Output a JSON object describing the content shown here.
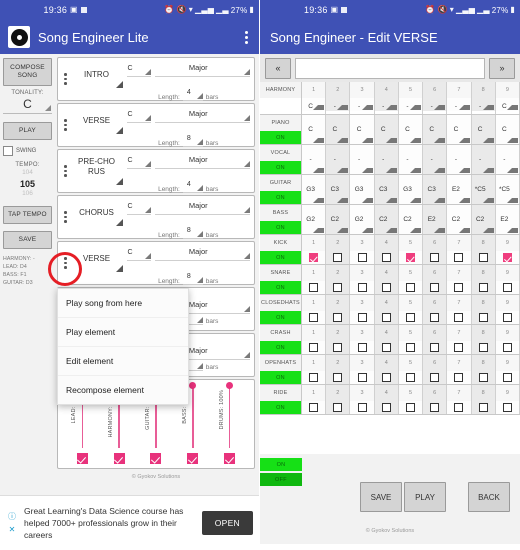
{
  "status_bar": {
    "time": "19:36",
    "battery": "27%",
    "icons": [
      "image-icon",
      "sim-icon",
      "alarm-icon",
      "mute-icon",
      "wifi-icon",
      "signal-icon",
      "signal2-icon"
    ]
  },
  "left": {
    "app_title": "Song Engineer Lite",
    "menu_icon": "kebab-menu-icon",
    "sidebar": {
      "compose_label": "COMPOSE\nSONG",
      "tonality_label": "TONALITY:",
      "tonality_value": "C",
      "play_label": "PLAY",
      "swing_label": "SWING",
      "tempo_label": "TEMPO:",
      "tempo_prev": "104",
      "tempo_current": "105",
      "tempo_next": "106",
      "tap_tempo_label": "TAP TEMPO",
      "save_label": "SAVE",
      "info_lines": [
        "HARMONY: -",
        "LEAD: D4",
        "BASS: F1",
        "GUITAR: D3"
      ]
    },
    "length_prefix": "Length:",
    "length_suffix": "bars",
    "cards": [
      {
        "name": "INTRO",
        "key": "C",
        "scale": "Major",
        "length": "4"
      },
      {
        "name": "VERSE",
        "key": "C",
        "scale": "Major",
        "length": "8"
      },
      {
        "name": "PRE-CHO\nRUS",
        "key": "C",
        "scale": "Major",
        "length": "4"
      },
      {
        "name": "CHORUS",
        "key": "C",
        "scale": "Major",
        "length": "8"
      },
      {
        "name": "VERSE",
        "key": "C",
        "scale": "Major",
        "length": "8"
      },
      {
        "name": "",
        "key": "",
        "scale": "Major",
        "length": ""
      },
      {
        "name": "",
        "key": "",
        "scale": "Major",
        "length": ""
      }
    ],
    "context_menu": [
      "Play song from here",
      "Play element",
      "Edit element",
      "Recompose element"
    ],
    "mixer": [
      {
        "label": "LEAD: 100%",
        "checked": true
      },
      {
        "label": "HARMONY: 100%",
        "checked": true
      },
      {
        "label": "GUITAR: 100%",
        "checked": true
      },
      {
        "label": "BASS: 100%",
        "checked": true
      },
      {
        "label": "DRUMS: 100%",
        "checked": true
      }
    ],
    "copyright": "© Gyokov Solutions",
    "ad": {
      "text": "Great Learning's Data Science course has helped 7000+ professionals grow in their careers",
      "button": "OPEN",
      "info_icon": "info-icon",
      "close_icon": "close-icon"
    }
  },
  "right": {
    "app_title": "Song Engineer - Edit VERSE",
    "nav_prev": "«",
    "nav_next": "»",
    "columns": [
      "1",
      "2",
      "3",
      "4",
      "5",
      "6",
      "7",
      "8",
      "9"
    ],
    "on_label": "ON",
    "off_label": "OFF",
    "tracks": [
      {
        "name": "HARMONY",
        "type": "note",
        "has_on": false,
        "show_numbers": true,
        "values": [
          "C",
          "-",
          "-",
          "-",
          "-",
          "-",
          "-",
          "-",
          "C"
        ]
      },
      {
        "name": "PIANO",
        "type": "note",
        "has_on": true,
        "show_numbers": false,
        "values": [
          "C",
          "C",
          "C",
          "C",
          "C",
          "C",
          "C",
          "C",
          "C"
        ]
      },
      {
        "name": "VOCAL",
        "type": "note",
        "has_on": true,
        "show_numbers": false,
        "values": [
          "-",
          "-",
          "-",
          "-",
          "-",
          "-",
          "-",
          "-",
          "-"
        ]
      },
      {
        "name": "GUITAR",
        "type": "note",
        "has_on": true,
        "show_numbers": false,
        "values": [
          "G3",
          "C3",
          "G3",
          "C3",
          "G3",
          "C3",
          "E2",
          "*C5",
          "*C5"
        ]
      },
      {
        "name": "BASS",
        "type": "note",
        "has_on": true,
        "show_numbers": false,
        "values": [
          "G2",
          "C2",
          "G2",
          "C2",
          "C2",
          "E2",
          "C2",
          "C2",
          "E2"
        ]
      },
      {
        "name": "KICK",
        "type": "check",
        "has_on": true,
        "show_numbers": true,
        "values": [
          true,
          false,
          false,
          false,
          true,
          false,
          false,
          false,
          true
        ]
      },
      {
        "name": "SNARE",
        "type": "check",
        "has_on": true,
        "show_numbers": true,
        "values": [
          false,
          false,
          false,
          false,
          false,
          false,
          false,
          false,
          false
        ]
      },
      {
        "name": "CLOSEDHATS",
        "type": "check",
        "has_on": true,
        "show_numbers": true,
        "values": [
          false,
          false,
          false,
          false,
          false,
          false,
          false,
          false,
          false
        ]
      },
      {
        "name": "CRASH",
        "type": "check",
        "has_on": true,
        "show_numbers": true,
        "values": [
          false,
          false,
          false,
          false,
          false,
          false,
          false,
          false,
          false
        ]
      },
      {
        "name": "OPENHATS",
        "type": "check",
        "has_on": true,
        "show_numbers": true,
        "values": [
          false,
          false,
          false,
          false,
          false,
          false,
          false,
          false,
          false
        ]
      },
      {
        "name": "RIDE",
        "type": "check",
        "has_on": true,
        "show_numbers": true,
        "values": [
          false,
          false,
          false,
          false,
          false,
          false,
          false,
          false,
          false
        ]
      }
    ],
    "buttons": {
      "save": "SAVE",
      "play": "PLAY",
      "back": "BACK"
    },
    "copyright": "© Gyokov Solutions"
  },
  "colors": {
    "appbar": "#3f51b5",
    "green": "#16e016",
    "green_dark": "#0fb80f",
    "pink": "#ef3d7e",
    "red_circle": "#e51e25"
  }
}
